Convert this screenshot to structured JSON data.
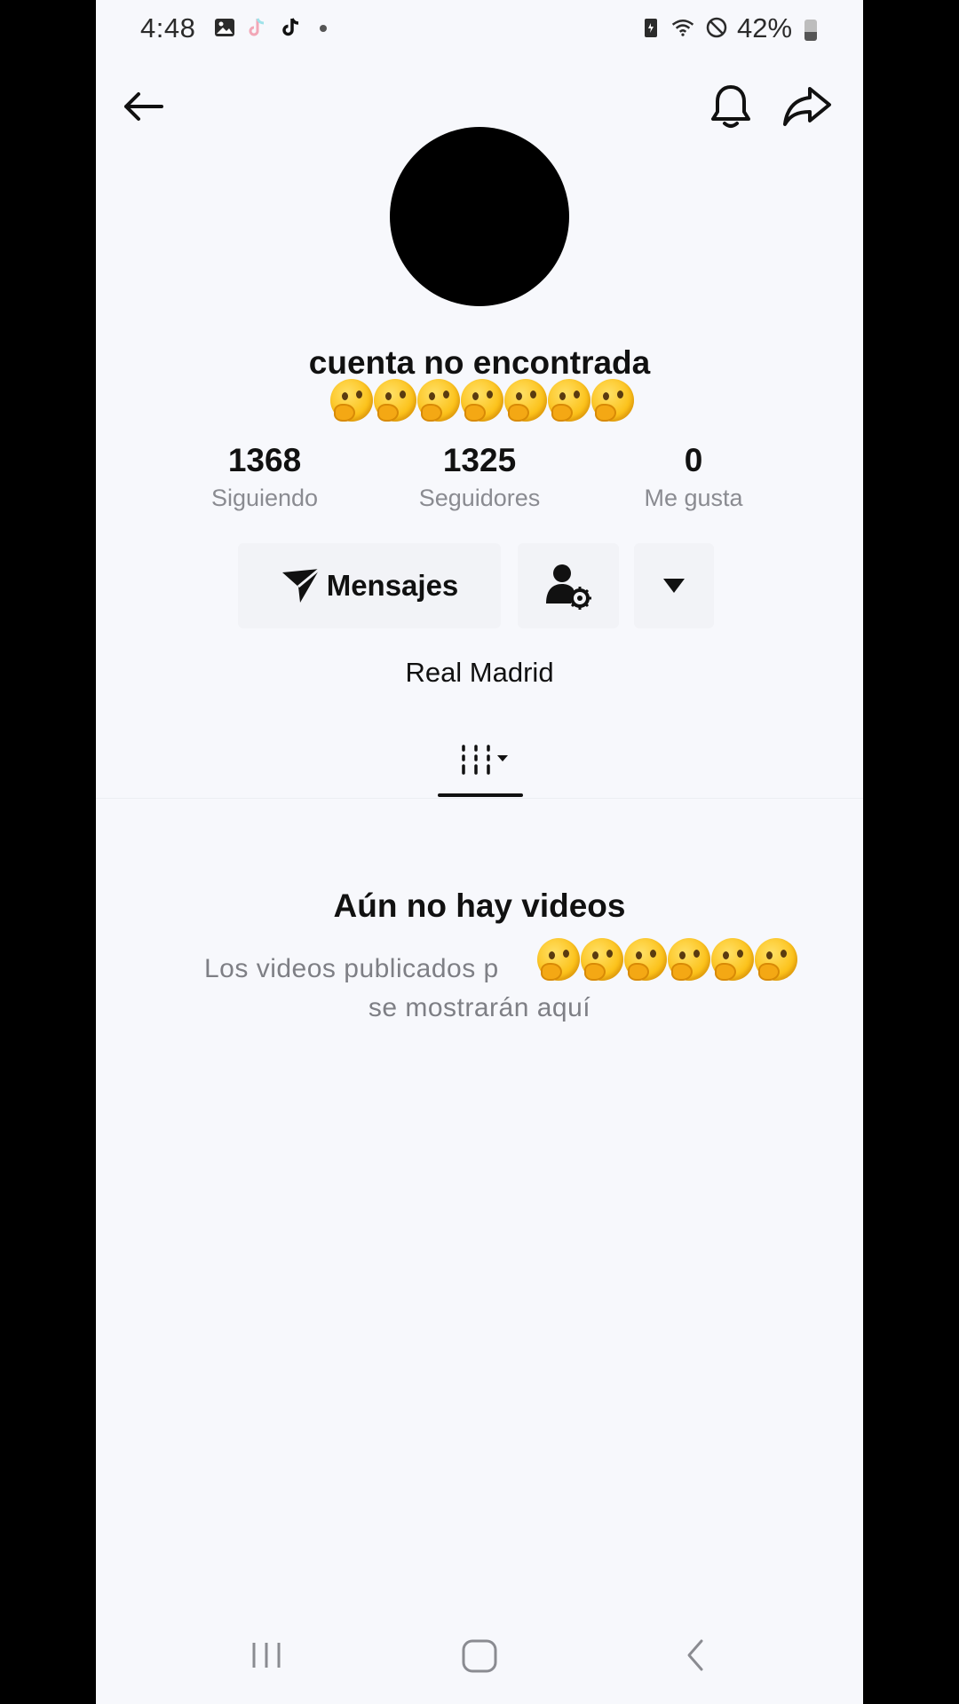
{
  "status_bar": {
    "time": "4:48",
    "battery": "42%",
    "icons": [
      "gallery-icon",
      "tiktok-icon",
      "tiktok-icon",
      "battery-saver-icon",
      "wifi-icon",
      "do-not-disturb-icon"
    ]
  },
  "header": {
    "back_icon": "arrow-left-icon",
    "bell_icon": "bell-icon",
    "share_icon": "share-arrow-icon"
  },
  "profile": {
    "title": "cuenta no encontrada",
    "bio": "Real Madrid"
  },
  "stats": [
    {
      "value": "1368",
      "label": "Siguiendo"
    },
    {
      "value": "1325",
      "label": "Seguidores"
    },
    {
      "value": "0",
      "label": "Me gusta"
    }
  ],
  "actions": {
    "message_label": "Mensajes"
  },
  "empty_state": {
    "title": "Aún no hay videos",
    "line1": "Los videos publicados p",
    "line2": "se mostrarán aquí"
  },
  "colors": {
    "background": "#f7f8fc",
    "button_bg": "#f2f3f7",
    "text_primary": "#111111",
    "text_secondary": "#8a8b91"
  }
}
